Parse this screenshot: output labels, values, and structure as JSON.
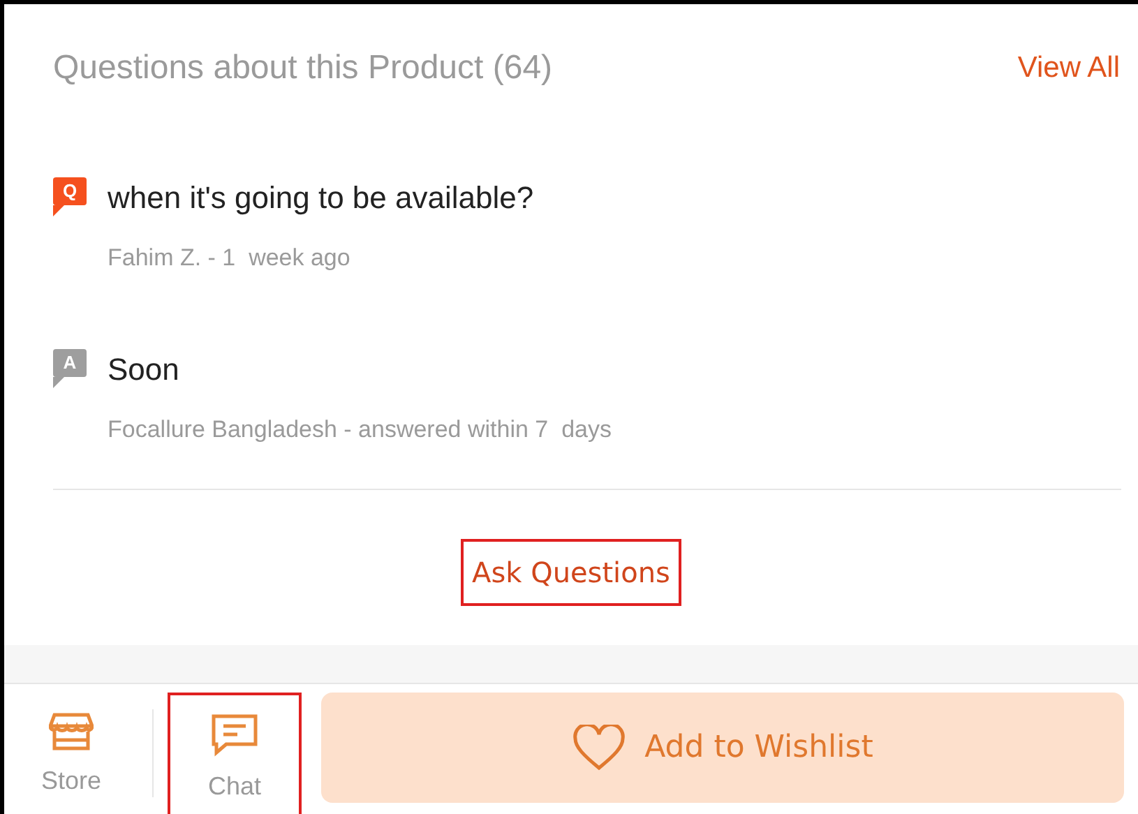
{
  "section": {
    "title": "Questions about this Product (64)",
    "view_all": "View All"
  },
  "entries": [
    {
      "kind": "question",
      "badge": "Q",
      "text": "when it's going to be available?",
      "meta": "Fahim Z. - 1  week ago"
    },
    {
      "kind": "answer",
      "badge": "A",
      "text": "Soon",
      "meta": "Focallure Bangladesh - answered within 7  days"
    }
  ],
  "ask_button": {
    "label": "Ask Questions",
    "highlighted": true
  },
  "bottom_bar": {
    "nav": [
      {
        "kind": "store",
        "label": "Store",
        "highlighted": false
      },
      {
        "kind": "chat",
        "label": "Chat",
        "highlighted": true
      }
    ],
    "wishlist_button": {
      "label": "Add to Wishlist"
    }
  }
}
